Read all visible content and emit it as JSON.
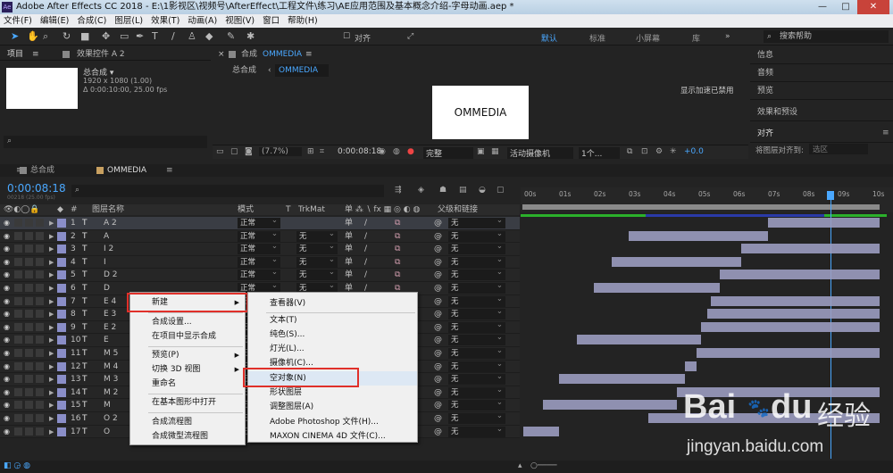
{
  "title": "Adobe After Effects CC 2018 - E:\\1影视区\\视频号\\AfterEffect\\工程文件\\练习\\AE应用范围及基本概念介绍-字母动画.aep *",
  "app_icon": "Ae",
  "window_buttons": [
    "—",
    "□",
    "✕"
  ],
  "menu": [
    "文件(F)",
    "编辑(E)",
    "合成(C)",
    "图层(L)",
    "效果(T)",
    "动画(A)",
    "视图(V)",
    "窗口",
    "帮助(H)"
  ],
  "toolbar": {
    "align_label": "对齐",
    "workspaces": [
      "默认",
      "标准",
      "小屏幕",
      "库"
    ],
    "search": "搜索帮助"
  },
  "project": {
    "tab": "项目",
    "tab2": "效果控件 A 2",
    "comp_name": "总合成 ▾",
    "comp_info1": "1920 x 1080 (1.00)",
    "comp_info2": "Δ 0:00:10:00, 25.00 fps",
    "search_icon": "⌕"
  },
  "viewer": {
    "tab": "合成",
    "tab_comp": "OMMEDIA",
    "crumb_parent": "总合成",
    "crumb_current": "OMMEDIA",
    "text": "OMMEDIA",
    "gpu_notice": "显示加速已禁用",
    "zoom": "(7.7%)",
    "timecode": "0:00:08:18",
    "quality": "完整",
    "camera": "活动摄像机",
    "views": "1个...",
    "offset": "+0.0"
  },
  "right": {
    "items": [
      "信息",
      "音频",
      "预览",
      "效果和预设",
      "对齐"
    ],
    "align_to": "将图层对齐到:",
    "align_sel": "选区"
  },
  "timeline": {
    "tab1": "总合成",
    "tab2": "OMMEDIA",
    "timecode": "0:00:08:18",
    "frames": "00218 (25.00 fps)",
    "col_layer": "图层名称",
    "col_mode": "模式",
    "col_t": "T",
    "col_trk": "TrkMat",
    "col_parent": "父级和链接",
    "ticks": [
      "00s",
      "01s",
      "02s",
      "03s",
      "04s",
      "05s",
      "06s",
      "07s",
      "08s",
      "09s",
      "10s"
    ],
    "rows": [
      {
        "n": "1",
        "name": "A 2",
        "mode": "正常",
        "trk": "",
        "parent": "无"
      },
      {
        "n": "2",
        "name": "A",
        "mode": "正常",
        "trk": "无",
        "parent": "无"
      },
      {
        "n": "3",
        "name": "I 2",
        "mode": "正常",
        "trk": "无",
        "parent": "无"
      },
      {
        "n": "4",
        "name": "I",
        "mode": "正常",
        "trk": "无",
        "parent": "无"
      },
      {
        "n": "5",
        "name": "D 2",
        "mode": "正常",
        "trk": "无",
        "parent": "无"
      },
      {
        "n": "6",
        "name": "D",
        "mode": "正常",
        "trk": "无",
        "parent": "无"
      },
      {
        "n": "7",
        "name": "E 4",
        "mode": "正常",
        "trk": "无",
        "parent": "无"
      },
      {
        "n": "8",
        "name": "E 3",
        "mode": "正常",
        "trk": "无",
        "parent": "无"
      },
      {
        "n": "9",
        "name": "E 2",
        "mode": "正常",
        "trk": "无",
        "parent": "无"
      },
      {
        "n": "10",
        "name": "E",
        "mode": "正常",
        "trk": "无",
        "parent": "无"
      },
      {
        "n": "11",
        "name": "M 5",
        "mode": "正常",
        "trk": "无",
        "parent": "无"
      },
      {
        "n": "12",
        "name": "M 4",
        "mode": "正常",
        "trk": "无",
        "parent": "无"
      },
      {
        "n": "13",
        "name": "M 3",
        "mode": "正常",
        "trk": "无",
        "parent": "无"
      },
      {
        "n": "14",
        "name": "M 2",
        "mode": "正常",
        "trk": "无",
        "parent": "无"
      },
      {
        "n": "15",
        "name": "M",
        "mode": "正常",
        "trk": "无",
        "parent": "无"
      },
      {
        "n": "16",
        "name": "O 2",
        "mode": "正常",
        "trk": "无",
        "parent": "无"
      },
      {
        "n": "17",
        "name": "O",
        "mode": "正常",
        "trk": "无",
        "parent": "无"
      }
    ]
  },
  "context_menu": {
    "main": [
      "新建",
      "合成设置...",
      "在项目中显示合成",
      "预览(P)",
      "切换 3D 视图",
      "重命名",
      "在基本图形中打开",
      "合成流程图",
      "合成微型流程图"
    ],
    "sub": [
      "查看器(V)",
      "文本(T)",
      "纯色(S)...",
      "灯光(L)...",
      "摄像机(C)...",
      "空对象(N)",
      "形状图层",
      "调整图层(A)",
      "Adobe Photoshop 文件(H)...",
      "MAXON CINEMA 4D 文件(C)..."
    ]
  },
  "watermark": {
    "brand": "Bai",
    "brand_paw": "du",
    "brand_cn": "经验",
    "url": "jingyan.baidu.com"
  }
}
